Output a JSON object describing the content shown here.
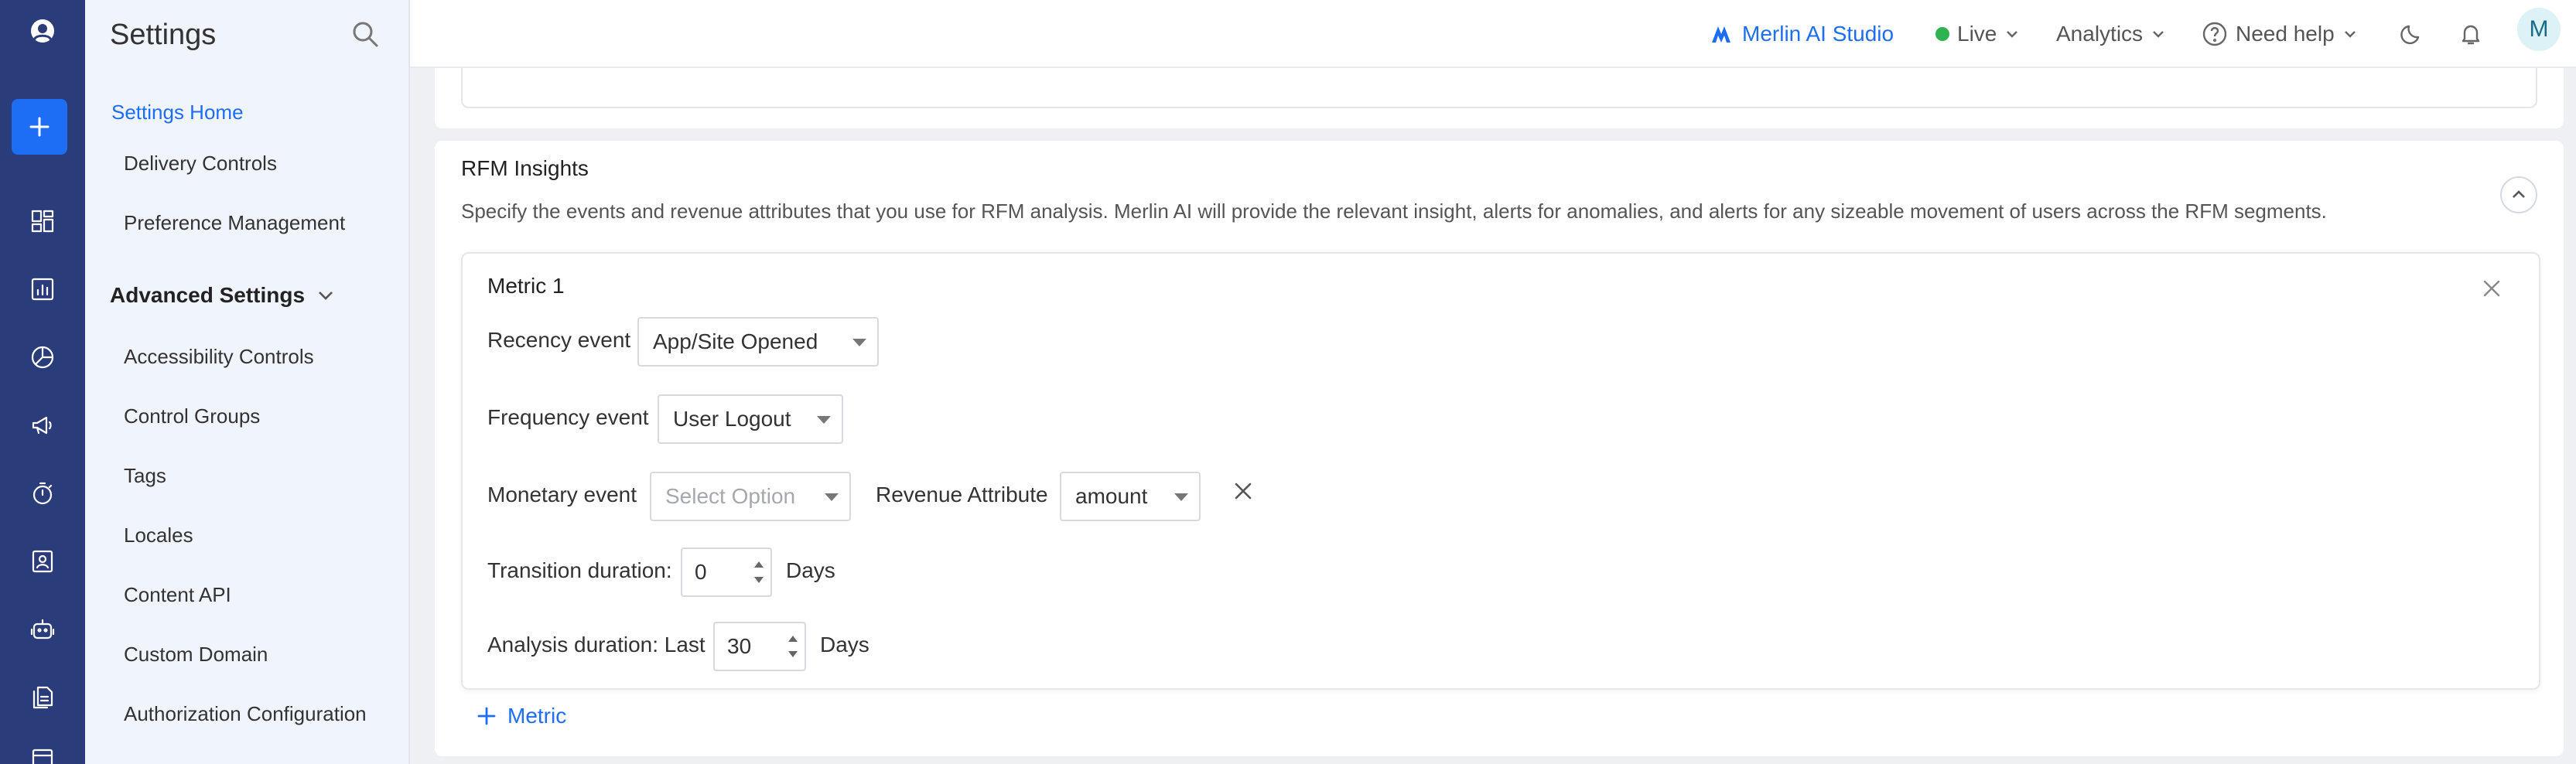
{
  "app": {
    "user_initial": "M"
  },
  "rail": {
    "icons": [
      "user-circle-icon",
      "plus-icon",
      "dashboard-icon",
      "bar-chart-icon",
      "pie-chart-icon",
      "megaphone-icon",
      "timer-icon",
      "contact-icon",
      "robot-icon",
      "documents-icon",
      "calendar-icon"
    ]
  },
  "sidebar": {
    "title": "Settings",
    "home": "Settings Home",
    "items": [
      "Delivery Controls",
      "Preference Management"
    ],
    "section": "Advanced Settings",
    "advanced_items": [
      "Accessibility Controls",
      "Control Groups",
      "Tags",
      "Locales",
      "Content API",
      "Custom Domain",
      "Authorization Configuration"
    ]
  },
  "header": {
    "merlin": "Merlin AI Studio",
    "env": "Live",
    "analytics": "Analytics",
    "help": "Need help",
    "live_color": "#2fb350",
    "accent": "#1e6df5"
  },
  "rfm": {
    "title": "RFM Insights",
    "description": "Specify the events and revenue attributes that you use for RFM analysis. Merlin AI will provide the relevant insight, alerts for anomalies, and alerts for any sizeable movement of users across the RFM segments.",
    "metric": {
      "title": "Metric 1",
      "recency_label": "Recency event",
      "recency_value": "App/Site Opened",
      "frequency_label": "Frequency event",
      "frequency_value": "User Logout",
      "monetary_label": "Monetary event",
      "monetary_placeholder": "Select Option",
      "revenue_label": "Revenue Attribute",
      "revenue_value": "amount",
      "transition_label": "Transition duration:",
      "transition_value": "0",
      "transition_unit": "Days",
      "analysis_label": "Analysis duration: Last",
      "analysis_value": "30",
      "analysis_unit": "Days"
    },
    "add_metric": "Metric"
  }
}
